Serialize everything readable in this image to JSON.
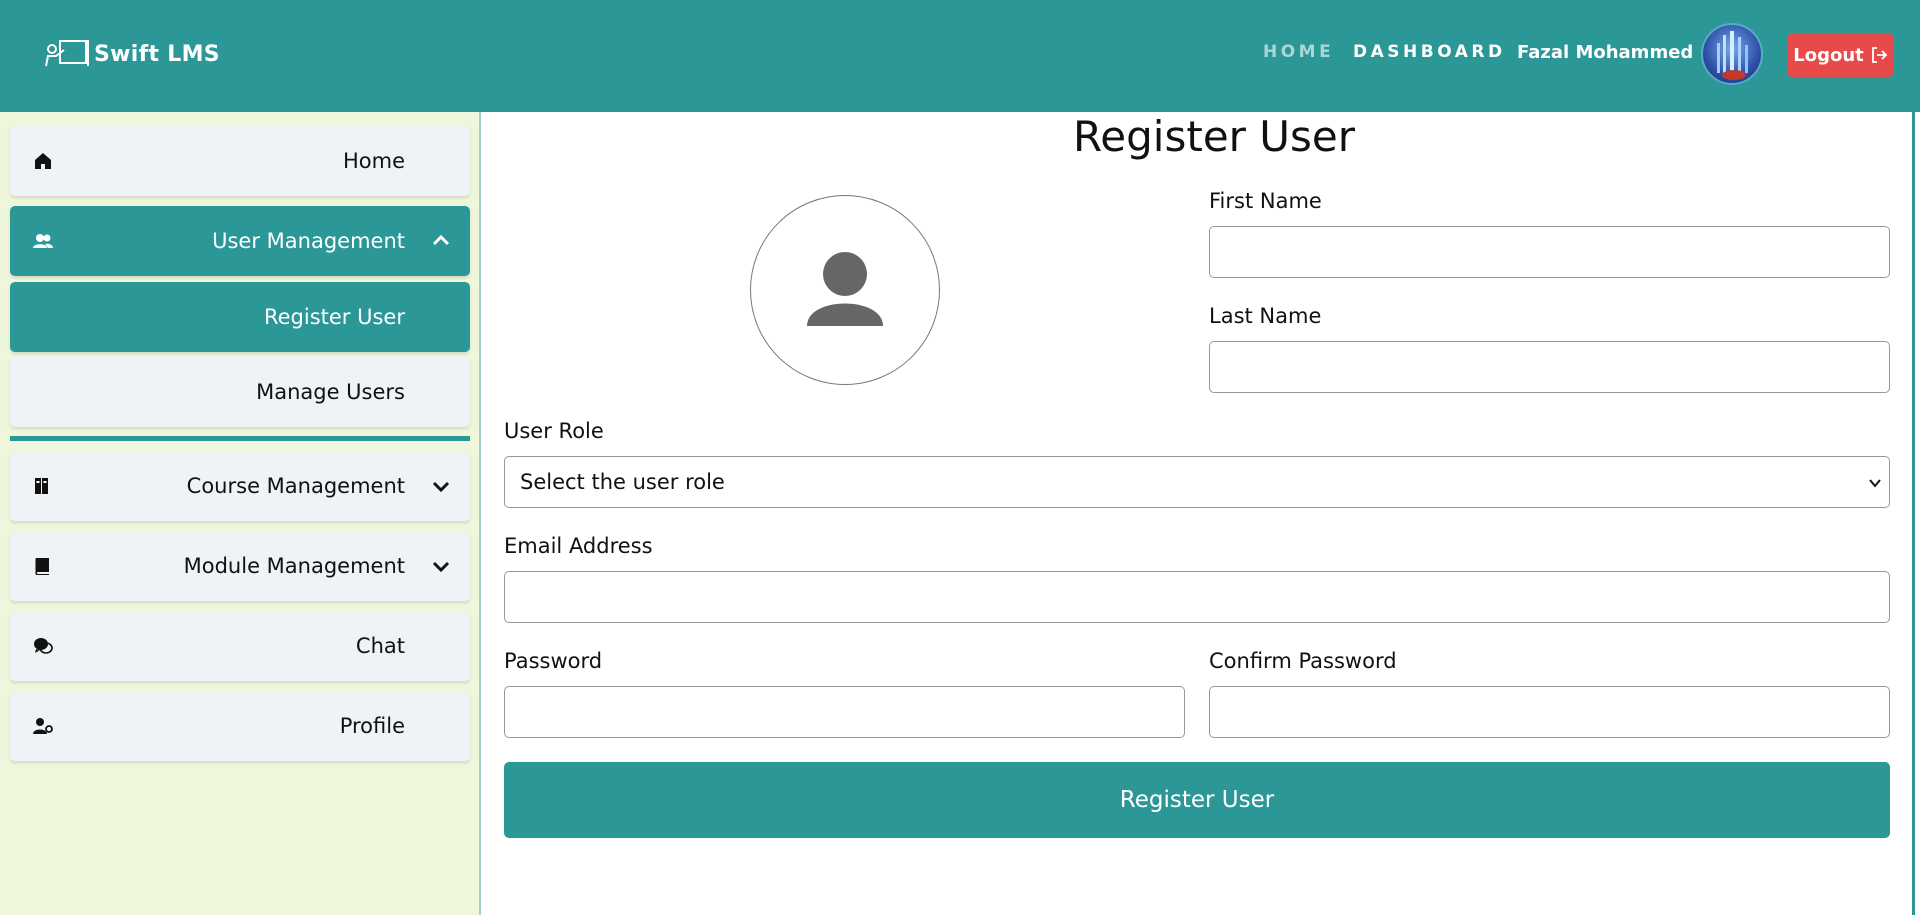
{
  "header": {
    "brand": "Swift LMS",
    "nav_home": "HOME",
    "nav_dashboard": "DASHBOARD",
    "user_name": "Fazal Mohammed",
    "logout_label": "Logout"
  },
  "sidebar": {
    "items": [
      {
        "label": "Home",
        "icon": "home-icon"
      },
      {
        "label": "User Management",
        "icon": "users-icon",
        "expanded": true
      },
      {
        "label": "Register User",
        "active": true
      },
      {
        "label": "Manage Users"
      },
      {
        "label": "Course Management",
        "icon": "books-icon",
        "expanded": false
      },
      {
        "label": "Module Management",
        "icon": "book-icon",
        "expanded": false
      },
      {
        "label": "Chat",
        "icon": "chat-icon"
      },
      {
        "label": "Profile",
        "icon": "user-gear-icon"
      }
    ]
  },
  "form": {
    "title": "Register User",
    "first_name_label": "First Name",
    "first_name_value": "",
    "last_name_label": "Last Name",
    "last_name_value": "",
    "role_label": "User Role",
    "role_selected": "Select the user role",
    "email_label": "Email Address",
    "email_value": "",
    "password_label": "Password",
    "confirm_password_label": "Confirm Password",
    "submit_label": "Register User"
  },
  "colors": {
    "primary": "#2c9797",
    "logout": "#e84a4a",
    "sidebar_bg": "#eef7dc",
    "item_bg": "#eef3f6"
  }
}
